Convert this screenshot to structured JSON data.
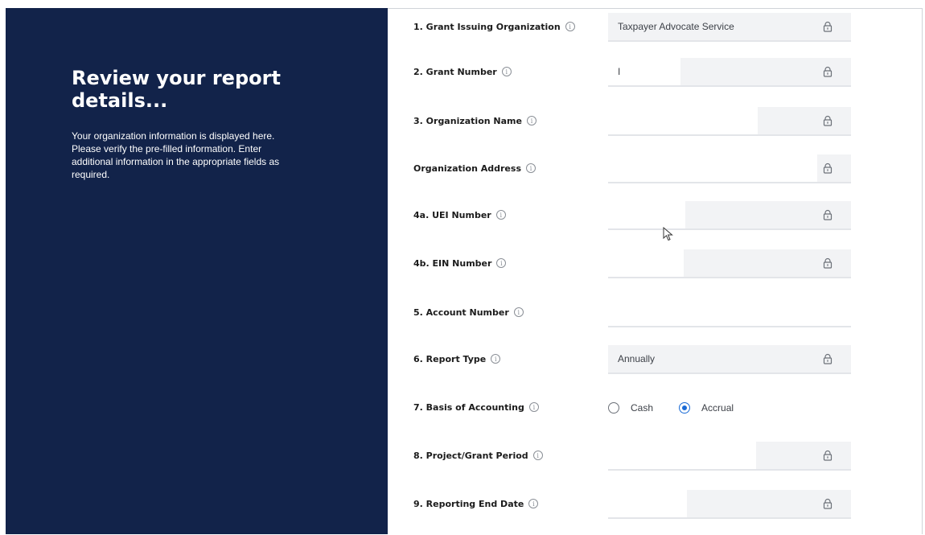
{
  "intro": {
    "heading": "Review your report details...",
    "description": "Your organization information is displayed here. Please verify the pre-filled information. Enter additional information in the appropriate fields as required."
  },
  "fields": [
    {
      "label": "1. Grant Issuing Organization",
      "value": "Taxpayer Advocate Service",
      "locked": true
    },
    {
      "label": "2. Grant Number",
      "value": "I",
      "locked": true
    },
    {
      "label": "3. Organization Name",
      "value": "",
      "locked": true
    },
    {
      "label": "Organization Address",
      "value": "",
      "locked": true
    },
    {
      "label": "4a. UEI Number",
      "value": "",
      "locked": true
    },
    {
      "label": "4b. EIN Number",
      "value": "",
      "locked": true
    },
    {
      "label": "5. Account Number",
      "value": "",
      "locked": false
    },
    {
      "label": "6. Report Type",
      "value": "Annually",
      "locked": true
    },
    {
      "label": "7. Basis of Accounting",
      "type": "radio",
      "options": [
        "Cash",
        "Accrual"
      ],
      "selected": "Accrual"
    },
    {
      "label": "8. Project/Grant Period",
      "value": "",
      "locked": true
    },
    {
      "label": "9. Reporting End Date",
      "value": "",
      "locked": true
    }
  ],
  "icons": {
    "info": "info-icon",
    "lock": "lock-icon"
  },
  "colors": {
    "panel": "#12234a",
    "field_bg": "#f2f3f5",
    "radio_accent": "#1a6bd6"
  }
}
